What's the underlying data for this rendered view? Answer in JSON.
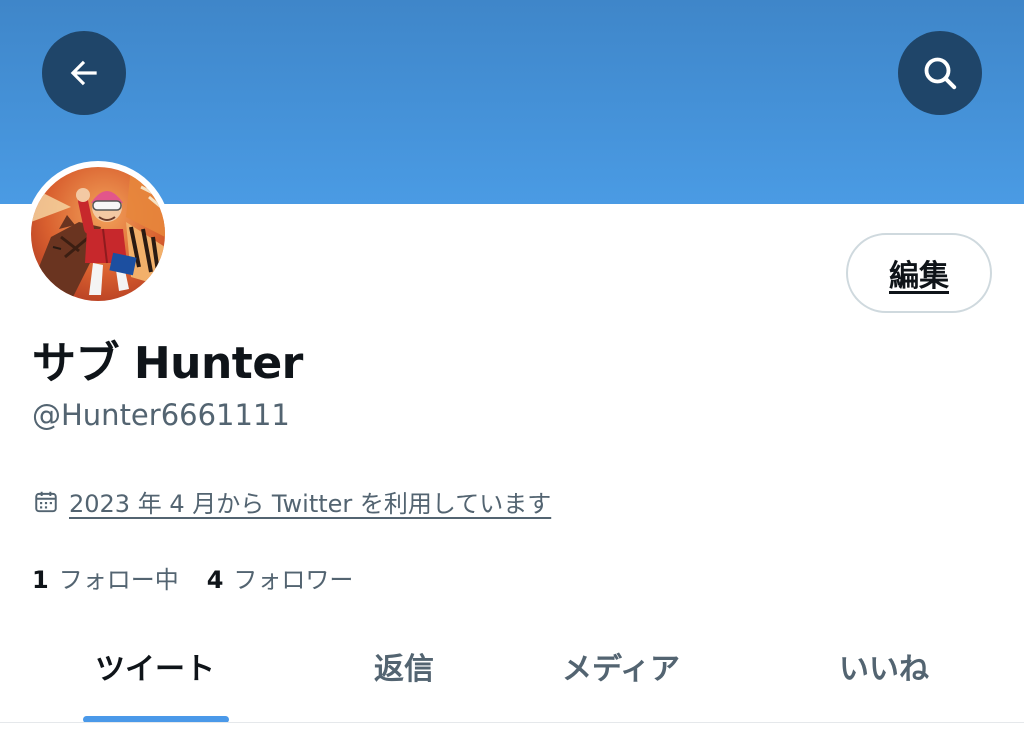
{
  "header": {
    "back_icon": "arrow-left-icon",
    "search_icon": "search-icon",
    "banner_color": "#4a9be4",
    "button_color": "#1f4569"
  },
  "profile": {
    "display_name": "サブ Hunter",
    "handle": "@Hunter6661111",
    "joined_icon": "calendar-icon",
    "joined_text": "2023 年 4 月から Twitter を利用しています",
    "edit_label": "編集",
    "following_count": "1",
    "following_label": "フォロー中",
    "followers_count": "4",
    "followers_label": "フォロワー"
  },
  "tabs": [
    {
      "label": "ツイート",
      "active": true
    },
    {
      "label": "返信",
      "active": false
    },
    {
      "label": "メディア",
      "active": false
    },
    {
      "label": "いいね",
      "active": false
    }
  ],
  "accent_color": "#4a99e9"
}
